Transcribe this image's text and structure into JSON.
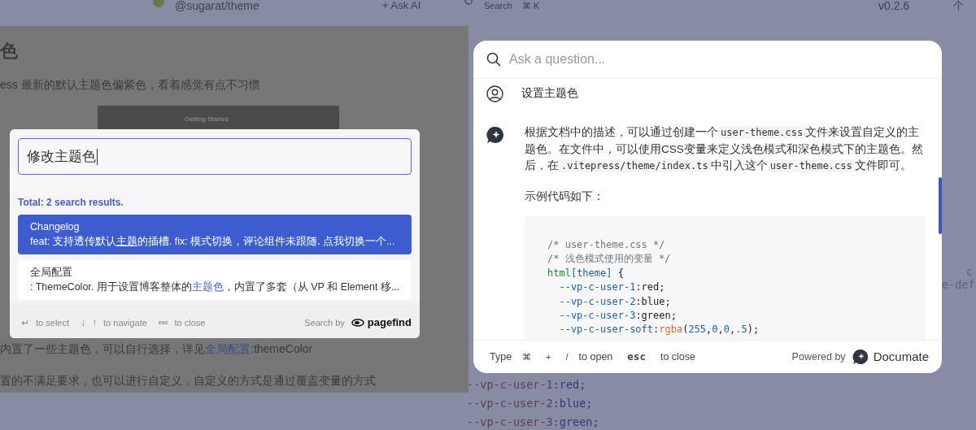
{
  "background_page": {
    "header": {
      "site_name": "@sugarat/theme",
      "ask_ai": "+ Ask AI",
      "search": "Search",
      "search_shortcut": "⌘ K",
      "version": "v0.2.6",
      "menu_item": "个"
    },
    "article": {
      "heading": "色",
      "intro": "ess 最新的默认主题色偏紫色，看着感觉有点不习惯",
      "screenshot_title": "Getting Started",
      "line_1_link": "全局配置",
      "line_1_rest": ":themeColor",
      "line_1_lead": "内置了一些主题色，可以自行选择，详见",
      "line_2": "置的不满足要求，也可以进行自定义，自定义的方式是通过覆盖变量的方式"
    },
    "code_fragments": [
      "c",
      "e-def"
    ],
    "code_lines": [
      {
        "prop": "--vp-c-user-1",
        "value": ":red;"
      },
      {
        "prop": "--vp-c-user-2",
        "value": ":blue;"
      },
      {
        "prop": "--vp-c-user-3",
        "value": ":green;"
      }
    ]
  },
  "search_modal": {
    "query": "修改主题色",
    "summary": "Total: 2 search results.",
    "results": [
      {
        "title": "Changelog",
        "selected": true,
        "excerpt": [
          {
            "text": "feat: 支持透传默认",
            "highlight": false
          },
          {
            "text": "主题",
            "highlight": true
          },
          {
            "text": "的插槽. fix: 模式切换，评论组件未跟随. 点我切换一个...",
            "highlight": false
          }
        ]
      },
      {
        "title": "全局配置",
        "selected": false,
        "excerpt": [
          {
            "text": ": ThemeColor. 用于设置博客整体的",
            "highlight": false
          },
          {
            "text": "主题色",
            "highlight": true
          },
          {
            "text": "，内置了多套（从 VP 和 Element 移...",
            "highlight": false
          }
        ]
      }
    ],
    "hints": [
      {
        "keys": [
          {
            "kind": "enter",
            "text": "↵"
          }
        ],
        "label": "to select"
      },
      {
        "keys": [
          {
            "kind": "arrow",
            "text": "↓"
          },
          {
            "kind": "arrow",
            "text": "↑"
          }
        ],
        "label": "to navigate"
      },
      {
        "keys": [
          {
            "kind": "esc",
            "text": "esc"
          }
        ],
        "label": "to close"
      }
    ],
    "credit": "Search by",
    "brand": "pagefind"
  },
  "ai_modal": {
    "placeholder": "Ask a question...",
    "question": "设置主题色",
    "answer": [
      {
        "text": "根据文档中的描述，可以通过创建一个",
        "code": false
      },
      {
        "text": "user-theme.css",
        "code": true
      },
      {
        "text": "文件来设置自定义的主题色。在文件中，可以使用CSS变量来定义浅色模式和深色模式下的主题色。然后，在",
        "code": false
      },
      {
        "text": ".vitepress/theme/index.ts",
        "code": true
      },
      {
        "text": "中引入这个",
        "code": false
      },
      {
        "text": "user-theme.css",
        "code": true
      },
      {
        "text": "文件即可。",
        "code": false
      }
    ],
    "example_label": "示例代码如下：",
    "code": [
      [
        {
          "kind": "comment",
          "text": "/* user-theme.css */"
        }
      ],
      [
        {
          "kind": "comment",
          "text": "/* 浅色模式使用的变量 */"
        }
      ],
      [
        {
          "kind": "selector",
          "text": "html"
        },
        {
          "kind": "attr",
          "text": "[theme]"
        },
        {
          "kind": "plain",
          "text": " {"
        }
      ],
      [
        {
          "kind": "prop",
          "text": "  --vp-c-user-1"
        },
        {
          "kind": "plain",
          "text": ":red;"
        }
      ],
      [
        {
          "kind": "prop",
          "text": "  --vp-c-user-2"
        },
        {
          "kind": "plain",
          "text": ":blue;"
        }
      ],
      [
        {
          "kind": "prop",
          "text": "  --vp-c-user-3"
        },
        {
          "kind": "plain",
          "text": ":green;"
        }
      ],
      [
        {
          "kind": "prop",
          "text": "  --vp-c-user-soft"
        },
        {
          "kind": "plain",
          "text": ":"
        },
        {
          "kind": "func",
          "text": "rgba"
        },
        {
          "kind": "plain",
          "text": "("
        },
        {
          "kind": "number",
          "text": "255"
        },
        {
          "kind": "plain",
          "text": ","
        },
        {
          "kind": "number",
          "text": "0"
        },
        {
          "kind": "plain",
          "text": ","
        },
        {
          "kind": "number",
          "text": "0"
        },
        {
          "kind": "plain",
          "text": ","
        },
        {
          "kind": "number",
          "text": ".5"
        },
        {
          "kind": "plain",
          "text": ");"
        }
      ]
    ],
    "shortcuts": [
      {
        "kind": "word",
        "text": "Type"
      },
      {
        "kind": "key",
        "text": "⌘"
      },
      {
        "kind": "key",
        "text": "+"
      },
      {
        "kind": "key",
        "text": "/"
      },
      {
        "kind": "word",
        "text": "to open"
      },
      {
        "kind": "bold",
        "text": "esc"
      },
      {
        "kind": "word",
        "text": "to close"
      }
    ],
    "credit": "Powered by",
    "brand": "Documate"
  }
}
